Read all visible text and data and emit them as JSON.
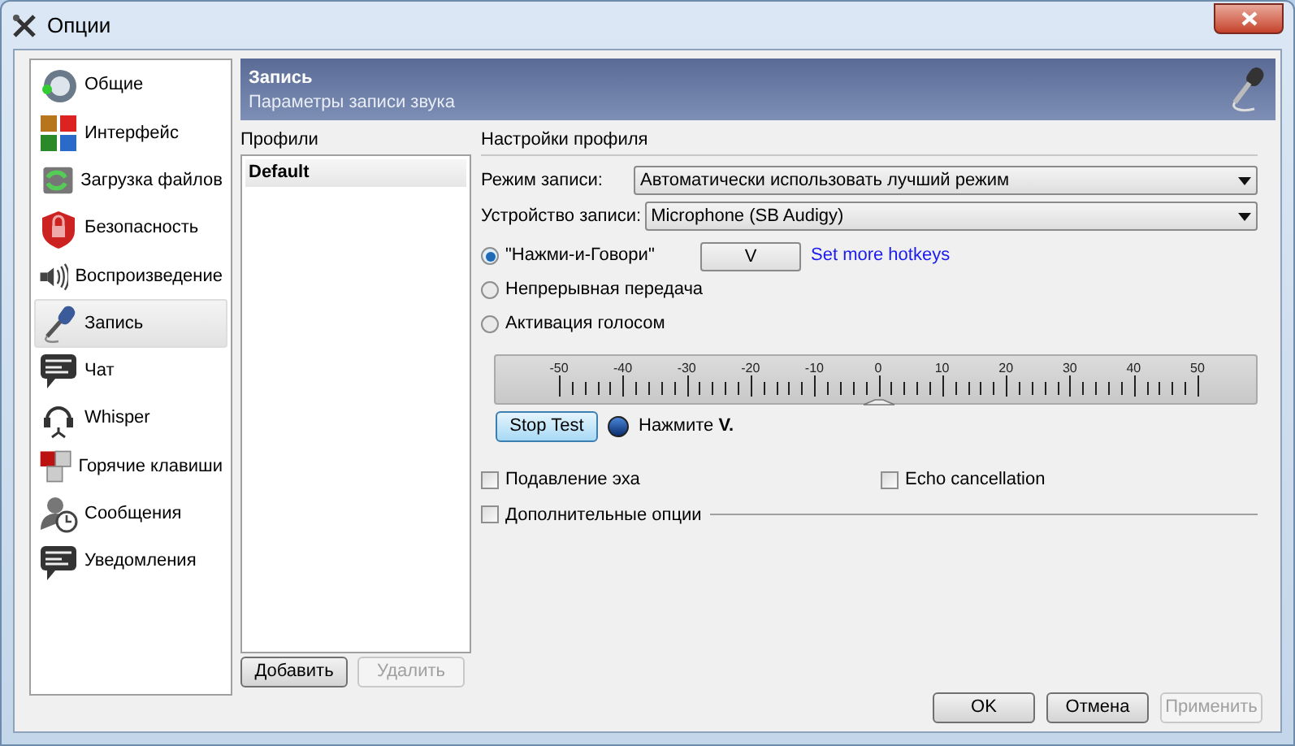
{
  "window": {
    "title": "Опции"
  },
  "sidebar": {
    "items": [
      {
        "label": "Общие",
        "selected": false
      },
      {
        "label": "Интерфейс",
        "selected": false
      },
      {
        "label": "Загрузка файлов",
        "selected": false
      },
      {
        "label": "Безопасность",
        "selected": false
      },
      {
        "label": "Воспроизведение",
        "selected": false
      },
      {
        "label": "Запись",
        "selected": true
      },
      {
        "label": "Чат",
        "selected": false
      },
      {
        "label": "Whisper",
        "selected": false
      },
      {
        "label": "Горячие клавиши",
        "selected": false
      },
      {
        "label": "Сообщения",
        "selected": false
      },
      {
        "label": "Уведомления",
        "selected": false
      }
    ]
  },
  "header": {
    "title": "Запись",
    "subtitle": "Параметры записи звука"
  },
  "profiles": {
    "label": "Профили",
    "items": [
      {
        "label": "Default",
        "selected": true
      }
    ],
    "buttons": [
      {
        "label": "Добавить",
        "disabled": false
      },
      {
        "label": "Удалить",
        "disabled": true
      }
    ]
  },
  "settings": {
    "title": "Настройки профиля",
    "fields": [
      {
        "label": "Режим записи:",
        "value": "Автоматически использовать лучший режим"
      },
      {
        "label": "Устройство записи:",
        "value": "Microphone (SB Audigy)"
      }
    ],
    "modes": [
      {
        "label": "\"Нажми-и-Говори\"",
        "selected": true,
        "hotkey": "V",
        "link": "Set more hotkeys"
      },
      {
        "label": "Непрерывная передача",
        "selected": false
      },
      {
        "label": "Активация голосом",
        "selected": false
      }
    ],
    "scale": {
      "ticks": [
        "-50",
        "-40",
        "-30",
        "-20",
        "-10",
        "0",
        "10",
        "20",
        "30",
        "40",
        "50"
      ],
      "level": 0.5
    },
    "test_button": "Stop Test",
    "indicator": {
      "on": true,
      "text": "Нажмите **V.**"
    },
    "options": [
      {
        "label": "Подавление эха",
        "checked": false
      },
      {
        "label": "Echo cancellation",
        "checked": false
      }
    ],
    "advanced": {
      "label": "Дополнительные опции",
      "checked": false
    }
  },
  "buttons": [
    {
      "label": "OK",
      "disabled": false
    },
    {
      "label": "Отмена",
      "disabled": false
    },
    {
      "label": "Применить",
      "disabled": true
    }
  ]
}
